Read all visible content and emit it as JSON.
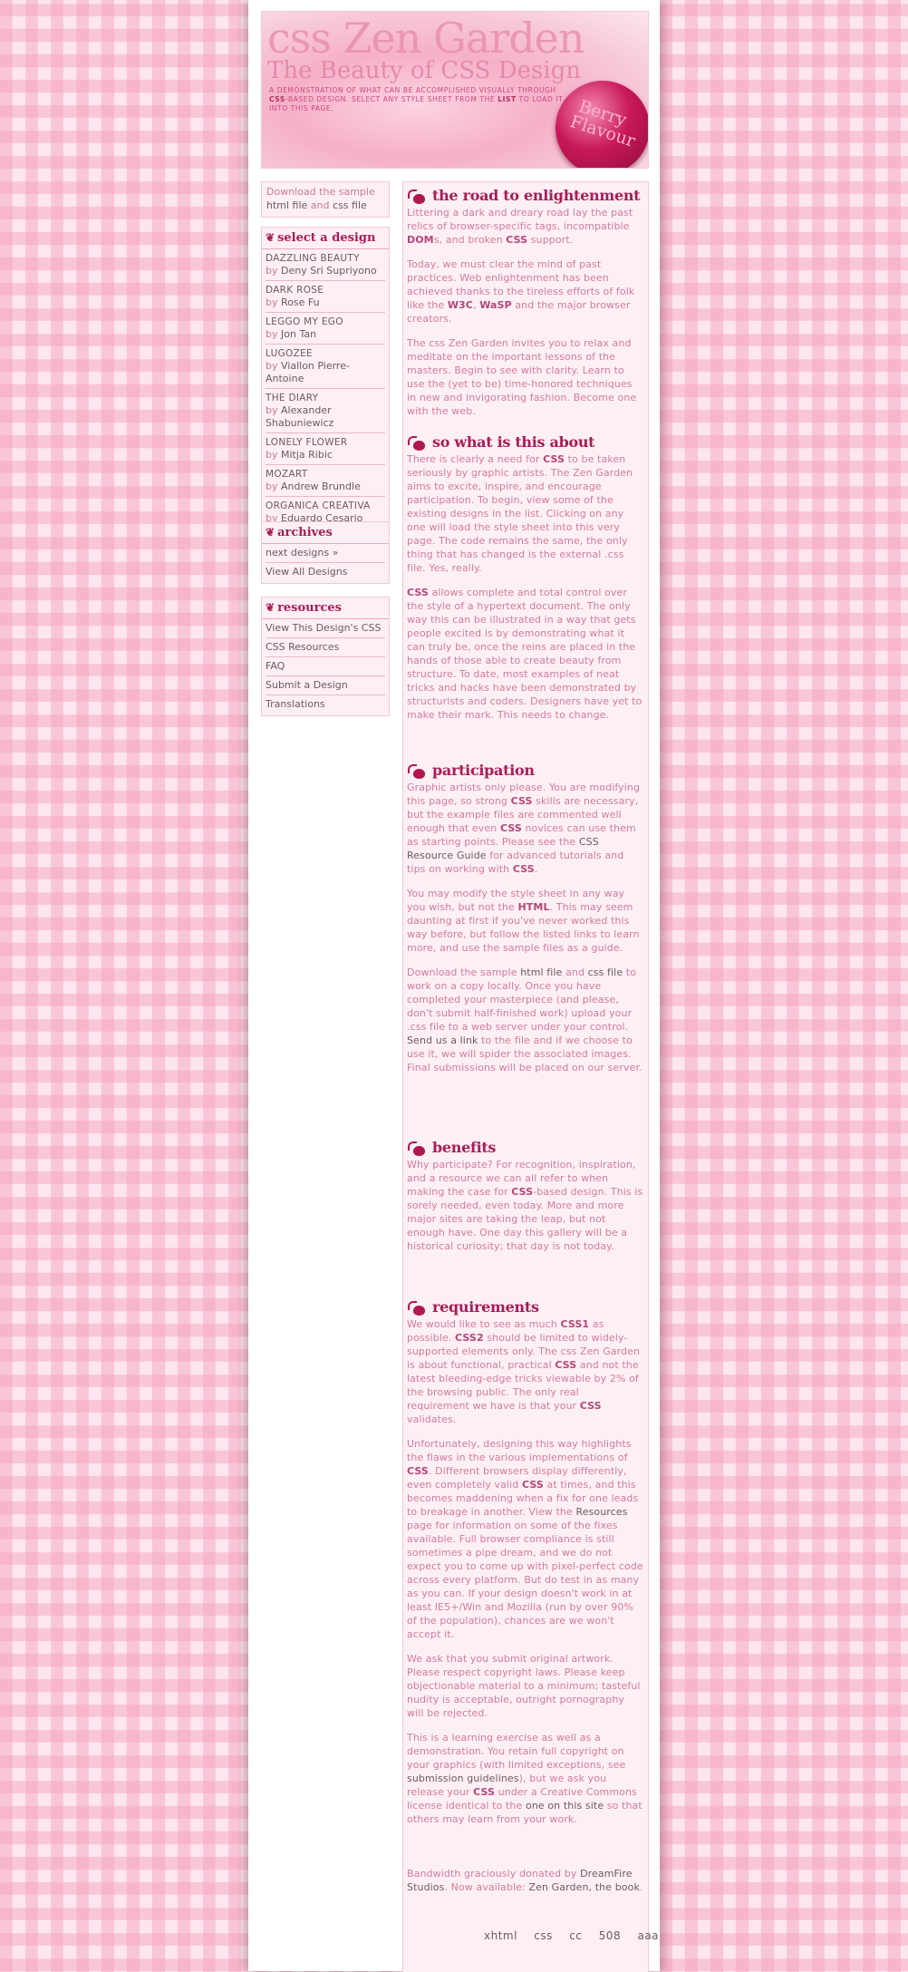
{
  "header": {
    "title": "css Zen Garden",
    "subtitle": "The Beauty of CSS Design",
    "summary_1": "A demonstration of what can be accomplished visually through ",
    "summary_css": "CSS",
    "summary_2": "-based design. Select any style sheet from the ",
    "summary_list": "list",
    "summary_3": " to load it into this page.",
    "badge_line1": "Berry",
    "badge_line2": "Flavour"
  },
  "download": {
    "prefix": "Download the sample ",
    "html_file": "html file",
    "and": " and ",
    "css_file": "css file"
  },
  "select_design": {
    "heading": "select a design",
    "by_label": "by ",
    "items": [
      {
        "name": "DAZZLING BEAUTY",
        "author": "Deny Sri Supriyono"
      },
      {
        "name": "DARK ROSE",
        "author": "Rose Fu"
      },
      {
        "name": "LEGGO MY EGO",
        "author": "Jon Tan"
      },
      {
        "name": "LUGOZEE",
        "author": "Viallon Pierre-Antoine"
      },
      {
        "name": "THE DIARY",
        "author": "Alexander Shabuniewicz"
      },
      {
        "name": "LONELY FLOWER",
        "author": "Mitja Ribic"
      },
      {
        "name": "MOZART",
        "author": "Andrew Brundle"
      },
      {
        "name": "ORGANICA CREATIVA",
        "author": "Eduardo Cesario"
      }
    ]
  },
  "archives": {
    "heading": "archives",
    "items": [
      "next designs »",
      "View All Designs"
    ]
  },
  "resources": {
    "heading": "resources",
    "items": [
      "View This Design's CSS",
      "CSS Resources",
      "FAQ",
      "Submit a Design",
      "Translations"
    ]
  },
  "sections": {
    "enlightenment": {
      "heading": "the road to enlightenment",
      "p1_a": "Littering a dark and dreary road lay the past relics of browser-specific tags, incompatible ",
      "p1_dom": "DOM",
      "p1_b": "s, and broken ",
      "p1_css": "CSS",
      "p1_c": " support.",
      "p2_a": "Today, we must clear the mind of past practices. Web enlightenment has been achieved thanks to the tireless efforts of folk like the ",
      "p2_w3c": "W3C",
      "p2_b": ", ",
      "p2_wasp": "WaSP",
      "p2_c": " and the major browser creators.",
      "p3": "The css Zen Garden invites you to relax and meditate on the important lessons of the masters. Begin to see with clarity. Learn to use the (yet to be) time-honored techniques in new and invigorating fashion. Become one with the web."
    },
    "about": {
      "heading": "so what is this about",
      "p1_a": "There is clearly a need for ",
      "p1_css": "CSS",
      "p1_b": " to be taken seriously by graphic artists. The Zen Garden aims to excite, inspire, and encourage participation. To begin, view some of the existing designs in the list. Clicking on any one will load the style sheet into this very page. The code remains the same, the only thing that has changed is the external .css file. Yes, really.",
      "p2_css": "CSS",
      "p2": " allows complete and total control over the style of a hypertext document. The only way this can be illustrated in a way that gets people excited is by demonstrating what it can truly be, once the reins are placed in the hands of those able to create beauty from structure. To date, most examples of neat tricks and hacks have been demonstrated by structurists and coders. Designers have yet to make their mark. This needs to change."
    },
    "participation": {
      "heading": "participation",
      "p1_a": "Graphic artists only please. You are modifying this page, so strong ",
      "p1_css1": "CSS",
      "p1_b": " skills are necessary, but the example files are commented well enough that even ",
      "p1_css2": "CSS",
      "p1_c": " novices can use them as starting points. Please see the ",
      "p1_link": "CSS Resource Guide",
      "p1_d": " for advanced tutorials and tips on working with ",
      "p1_css3": "CSS",
      "p1_e": ".",
      "p2_a": "You may modify the style sheet in any way you wish, but not the ",
      "p2_html": "HTML",
      "p2_b": ". This may seem daunting at first if you've never worked this way before, but follow the listed links to learn more, and use the sample files as a guide.",
      "p3_a": "Download the sample ",
      "p3_html": "html file",
      "p3_and": " and ",
      "p3_css": "css file",
      "p3_b": " to work on a copy locally. Once you have completed your masterpiece (and please, don't submit half-finished work) upload your .css file to a web server under your control. ",
      "p3_link": "Send us a link",
      "p3_c": " to the file and if we choose to use it, we will spider the associated images. Final submissions will be placed on our server."
    },
    "benefits": {
      "heading": "benefits",
      "p1_a": "Why participate? For recognition, inspiration, and a resource we can all refer to when making the case for ",
      "p1_css": "CSS",
      "p1_b": "-based design. This is sorely needed, even today. More and more major sites are taking the leap, but not enough have. One day this gallery will be a historical curiosity; that day is not today."
    },
    "requirements": {
      "heading": "requirements",
      "p1_a": "We would like to see as much ",
      "p1_css1": "CSS1",
      "p1_b": " as possible. ",
      "p1_css2": "CSS2",
      "p1_c": " should be limited to widely-supported elements only. The css Zen Garden is about functional, practical ",
      "p1_css3": "CSS",
      "p1_d": " and not the latest bleeding-edge tricks viewable by 2% of the browsing public. The only real requirement we have is that your ",
      "p1_css4": "CSS",
      "p1_e": " validates.",
      "p2_a": "Unfortunately, designing this way highlights the flaws in the various implementations of ",
      "p2_css1": "CSS",
      "p2_b": ". Different browsers display differently, even completely valid ",
      "p2_css2": "CSS",
      "p2_c": " at times, and this becomes maddening when a fix for one leads to breakage in another. View the ",
      "p2_link": "Resources",
      "p2_d": " page for information on some of the fixes available. Full browser compliance is still sometimes a pipe dream, and we do not expect you to come up with pixel-perfect code across every platform. But do test in as many as you can. If your design doesn't work in at least IE5+/Win and Mozilla (run by over 90% of the population), chances are we won't accept it.",
      "p3": "We ask that you submit original artwork. Please respect copyright laws. Please keep objectionable material to a minimum; tasteful nudity is acceptable, outright pornography will be rejected.",
      "p4_a": "This is a learning exercise as well as a demonstration. You retain full copyright on your graphics (with limited exceptions, see ",
      "p4_link1": "submission guidelines",
      "p4_b": "), but we ask you release your ",
      "p4_css": "CSS",
      "p4_c": " under a Creative Commons license identical to the ",
      "p4_link2": "one on this site",
      "p4_d": " so that others may learn from your work."
    },
    "bandwidth": {
      "a": "Bandwidth graciously donated by ",
      "link1": "DreamFire Studios",
      "b": ". Now available: ",
      "link2": "Zen Garden, the book",
      "c": "."
    }
  },
  "footer": [
    "xhtml",
    "css",
    "cc",
    "508",
    "aaa"
  ]
}
